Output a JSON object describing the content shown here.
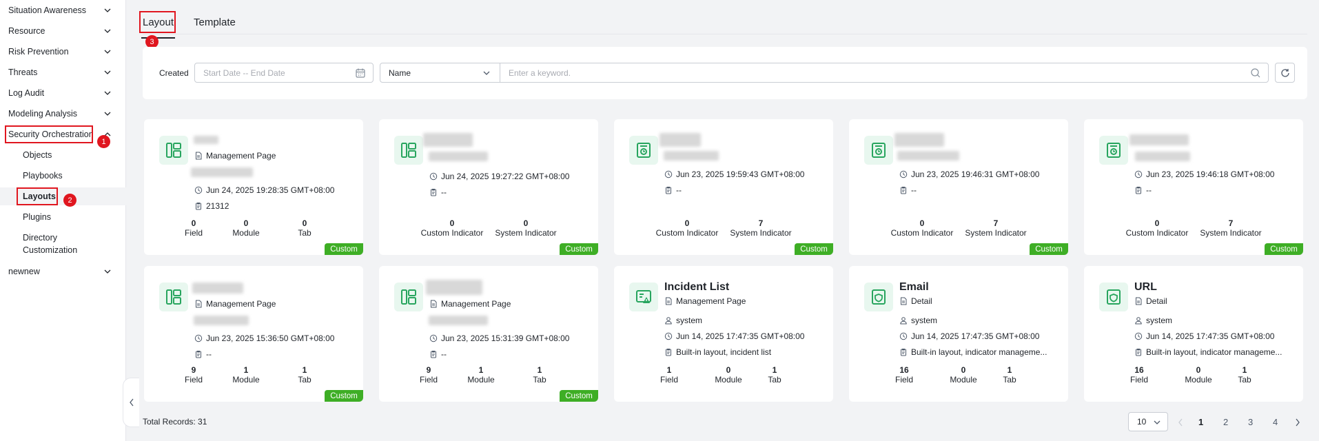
{
  "sidebar": {
    "items": [
      {
        "label": "Situation Awareness"
      },
      {
        "label": "Resource"
      },
      {
        "label": "Risk Prevention"
      },
      {
        "label": "Threats"
      },
      {
        "label": "Log Audit"
      },
      {
        "label": "Modeling Analysis"
      },
      {
        "label": "Security Orchestration"
      },
      {
        "label": "Objects"
      },
      {
        "label": "Playbooks"
      },
      {
        "label": "Layouts"
      },
      {
        "label": "Plugins"
      },
      {
        "label": "Directory Customization"
      },
      {
        "label": "newnew"
      }
    ],
    "badges": [
      "1",
      "2"
    ]
  },
  "tabs": [
    {
      "label": "Layout"
    },
    {
      "label": "Template"
    }
  ],
  "tab_badge": "3",
  "filter": {
    "created_label": "Created",
    "date_placeholder": "Start Date -- End Date",
    "field_select": "Name",
    "keyword_placeholder": "Enter a keyword."
  },
  "cards": [
    {
      "title": "",
      "type": "Management Page",
      "time": "Jun 24, 2025 19:28:35 GMT+08:00",
      "desc": "21312",
      "stats": [
        {
          "num": "0",
          "label": "Field"
        },
        {
          "num": "0",
          "label": "Module"
        },
        {
          "num": "0",
          "label": "Tab"
        }
      ],
      "tag": "Custom"
    },
    {
      "title": "",
      "type": "",
      "time": "Jun 24, 2025 19:27:22 GMT+08:00",
      "desc": "--",
      "stats": [
        {
          "num": "0",
          "label": "Custom Indicator"
        },
        {
          "num": "0",
          "label": "System Indicator"
        }
      ],
      "tag": "Custom"
    },
    {
      "title": "",
      "type": "",
      "time": "Jun 23, 2025 19:59:43 GMT+08:00",
      "desc": "--",
      "stats": [
        {
          "num": "0",
          "label": "Custom Indicator"
        },
        {
          "num": "7",
          "label": "System Indicator"
        }
      ],
      "tag": "Custom"
    },
    {
      "title": "",
      "type": "",
      "time": "Jun 23, 2025 19:46:31 GMT+08:00",
      "desc": "--",
      "stats": [
        {
          "num": "0",
          "label": "Custom Indicator"
        },
        {
          "num": "7",
          "label": "System Indicator"
        }
      ],
      "tag": "Custom"
    },
    {
      "title": "",
      "type": "",
      "time": "Jun 23, 2025 19:46:18 GMT+08:00",
      "desc": "--",
      "stats": [
        {
          "num": "0",
          "label": "Custom Indicator"
        },
        {
          "num": "7",
          "label": "System Indicator"
        }
      ],
      "tag": "Custom"
    },
    {
      "title": "",
      "type": "Management Page",
      "time": "Jun 23, 2025 15:36:50 GMT+08:00",
      "desc": "--",
      "stats": [
        {
          "num": "9",
          "label": "Field"
        },
        {
          "num": "1",
          "label": "Module"
        },
        {
          "num": "1",
          "label": "Tab"
        }
      ],
      "tag": "Custom"
    },
    {
      "title": "",
      "type": "Management Page",
      "time": "Jun 23, 2025 15:31:39 GMT+08:00",
      "desc": "--",
      "stats": [
        {
          "num": "9",
          "label": "Field"
        },
        {
          "num": "1",
          "label": "Module"
        },
        {
          "num": "1",
          "label": "Tab"
        }
      ],
      "tag": "Custom"
    },
    {
      "title": "Incident List",
      "type": "Management Page",
      "user": "system",
      "time": "Jun 14, 2025 17:47:35 GMT+08:00",
      "desc": "Built-in layout, incident list",
      "stats": [
        {
          "num": "1",
          "label": "Field"
        },
        {
          "num": "0",
          "label": "Module"
        },
        {
          "num": "1",
          "label": "Tab"
        }
      ]
    },
    {
      "title": "Email",
      "type": "Detail",
      "user": "system",
      "time": "Jun 14, 2025 17:47:35 GMT+08:00",
      "desc": "Built-in layout, indicator manageme...",
      "stats": [
        {
          "num": "16",
          "label": "Field"
        },
        {
          "num": "0",
          "label": "Module"
        },
        {
          "num": "1",
          "label": "Tab"
        }
      ]
    },
    {
      "title": "URL",
      "type": "Detail",
      "user": "system",
      "time": "Jun 14, 2025 17:47:35 GMT+08:00",
      "desc": "Built-in layout, indicator manageme...",
      "stats": [
        {
          "num": "16",
          "label": "Field"
        },
        {
          "num": "0",
          "label": "Module"
        },
        {
          "num": "1",
          "label": "Tab"
        }
      ]
    }
  ],
  "footer": {
    "total": "Total Records: 31",
    "page_size": "10",
    "pages": [
      "1",
      "2",
      "3",
      "4"
    ]
  }
}
